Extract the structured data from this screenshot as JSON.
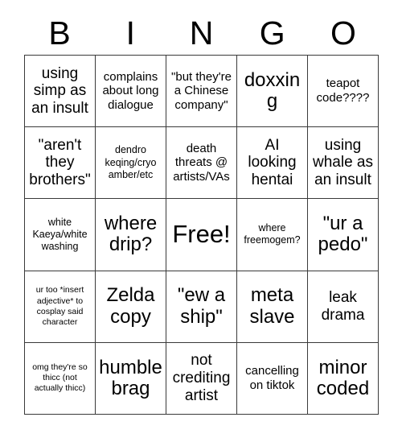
{
  "card": {
    "header_letters": [
      "B",
      "I",
      "N",
      "G",
      "O"
    ],
    "rows": [
      [
        {
          "text": "using simp as an insult",
          "size": "lg"
        },
        {
          "text": "complains about long dialogue",
          "size": "md"
        },
        {
          "text": "\"but they're a Chinese company\"",
          "size": "md"
        },
        {
          "text": "doxxing",
          "size": "xl"
        },
        {
          "text": "teapot code????",
          "size": "md"
        }
      ],
      [
        {
          "text": "\"aren't they brothers\"",
          "size": "lg"
        },
        {
          "text": "dendro keqing/cryo amber/etc",
          "size": "sm"
        },
        {
          "text": "death threats @ artists/VAs",
          "size": "md"
        },
        {
          "text": "AI looking hentai",
          "size": "lg"
        },
        {
          "text": "using whale as an insult",
          "size": "lg"
        }
      ],
      [
        {
          "text": "white Kaeya/white washing",
          "size": "sm"
        },
        {
          "text": "where drip?",
          "size": "xl"
        },
        {
          "text": "Free!",
          "size": "xxl"
        },
        {
          "text": "where freemogem?",
          "size": "sm"
        },
        {
          "text": "\"ur a pedo\"",
          "size": "xl"
        }
      ],
      [
        {
          "text": "ur too *insert adjective* to cosplay said character",
          "size": "xs"
        },
        {
          "text": "Zelda copy",
          "size": "xl"
        },
        {
          "text": "\"ew a ship\"",
          "size": "xl"
        },
        {
          "text": "meta slave",
          "size": "xl"
        },
        {
          "text": "leak drama",
          "size": "lg"
        }
      ],
      [
        {
          "text": "omg they're so thicc (not actually thicc)",
          "size": "xs"
        },
        {
          "text": "humble brag",
          "size": "xl"
        },
        {
          "text": "not crediting artist",
          "size": "lg"
        },
        {
          "text": "cancelling on tiktok",
          "size": "md"
        },
        {
          "text": "minor coded",
          "size": "xl"
        }
      ]
    ]
  },
  "colors": {
    "background": "#ffffff",
    "text": "#000000",
    "grid_line": "#3a3a3a"
  }
}
